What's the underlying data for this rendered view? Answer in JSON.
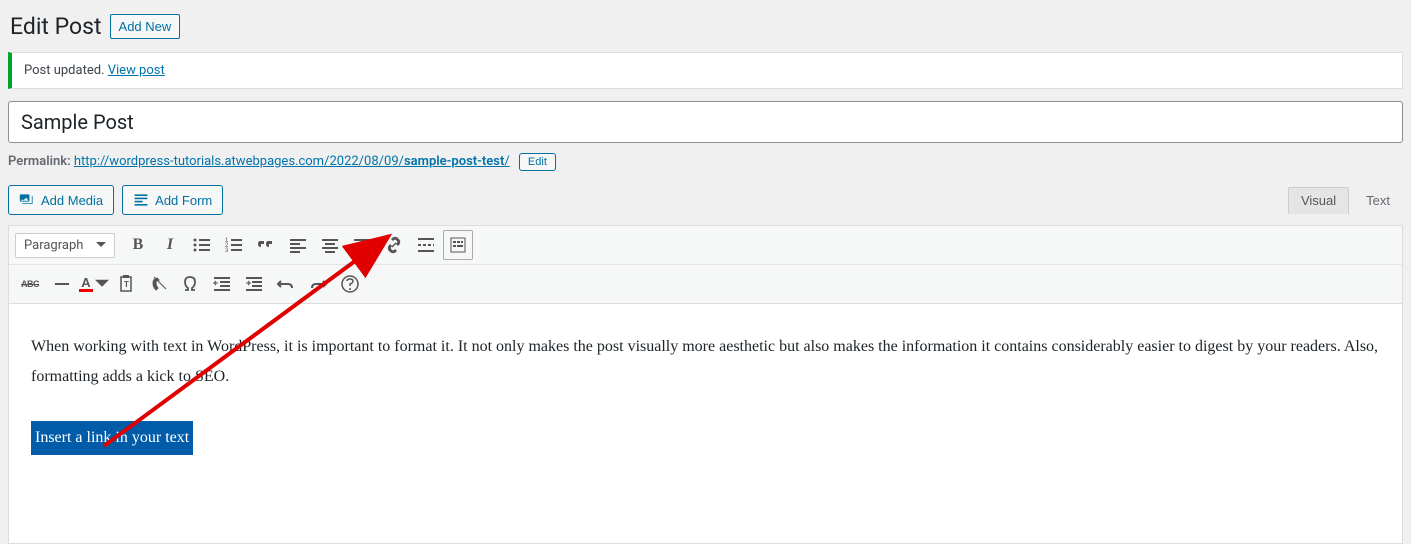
{
  "header": {
    "title": "Edit Post",
    "add_new_label": "Add New"
  },
  "notice": {
    "message": "Post updated.",
    "link_text": "View post"
  },
  "post": {
    "title": "Sample Post"
  },
  "permalink": {
    "label": "Permalink:",
    "url_base": "http://wordpress-tutorials.atwebpages.com/2022/08/09/",
    "slug": "sample-post-test",
    "edit_label": "Edit"
  },
  "buttons": {
    "add_media": "Add Media",
    "add_form": "Add Form"
  },
  "tabs": {
    "visual": "Visual",
    "text": "Text"
  },
  "toolbar": {
    "format_select": "Paragraph",
    "bold": "B",
    "italic": "I",
    "abc": "ABC",
    "color_letter": "A"
  },
  "content": {
    "paragraph1": "When working with text in WordPress, it is important to format it. It not only makes the post visually more aesthetic but also makes the information it contains considerably easier to digest by your readers. Also, formatting adds a kick to SEO.",
    "highlighted": "Insert a link in your text"
  }
}
